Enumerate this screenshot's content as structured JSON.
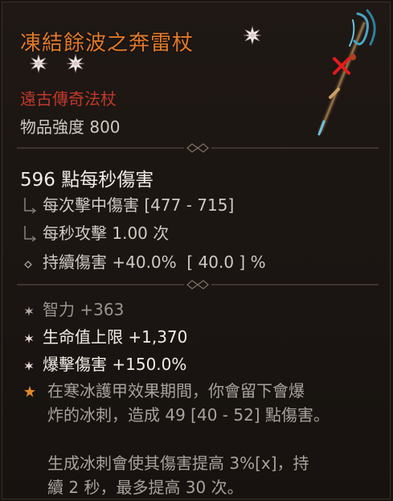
{
  "item": {
    "name": "凍結餘波之奔雷杖",
    "type": "遠古傳奇法杖",
    "power": "物品強度 800"
  },
  "weapon_stats": {
    "dps": "596 點每秒傷害",
    "damage_per_hit": "每次擊中傷害 [477 - 715]",
    "attack_speed": "每秒攻擊 1.00 次",
    "dot_damage": "持續傷害 +40.0%  [ 40.0 ] %"
  },
  "affixes": [
    {
      "text": "智力 +363",
      "style": "dim"
    },
    {
      "text": "生命值上限 +1,370",
      "style": "bright"
    },
    {
      "text": "爆擊傷害 +150.0%",
      "style": "bright"
    }
  ],
  "legendary": {
    "lines": [
      "在寒冰護甲效果期間，你會留下會爆",
      "炸的冰刺，造成 49 [40 - 52] 點傷害。",
      "",
      "生成冰刺會使其傷害提高 3%[x]，持",
      "續 2 秒，最多提高 30 次。"
    ]
  },
  "colors": {
    "title": "#e07a2b",
    "item_type": "#c0392b",
    "legendary_star": "#e08a2b"
  },
  "icons": [
    "gem-socket-icon",
    "weapon-staff-icon",
    "bracket-icon",
    "diamond-bullet-icon",
    "affix-star-icon",
    "legendary-star-icon"
  ]
}
